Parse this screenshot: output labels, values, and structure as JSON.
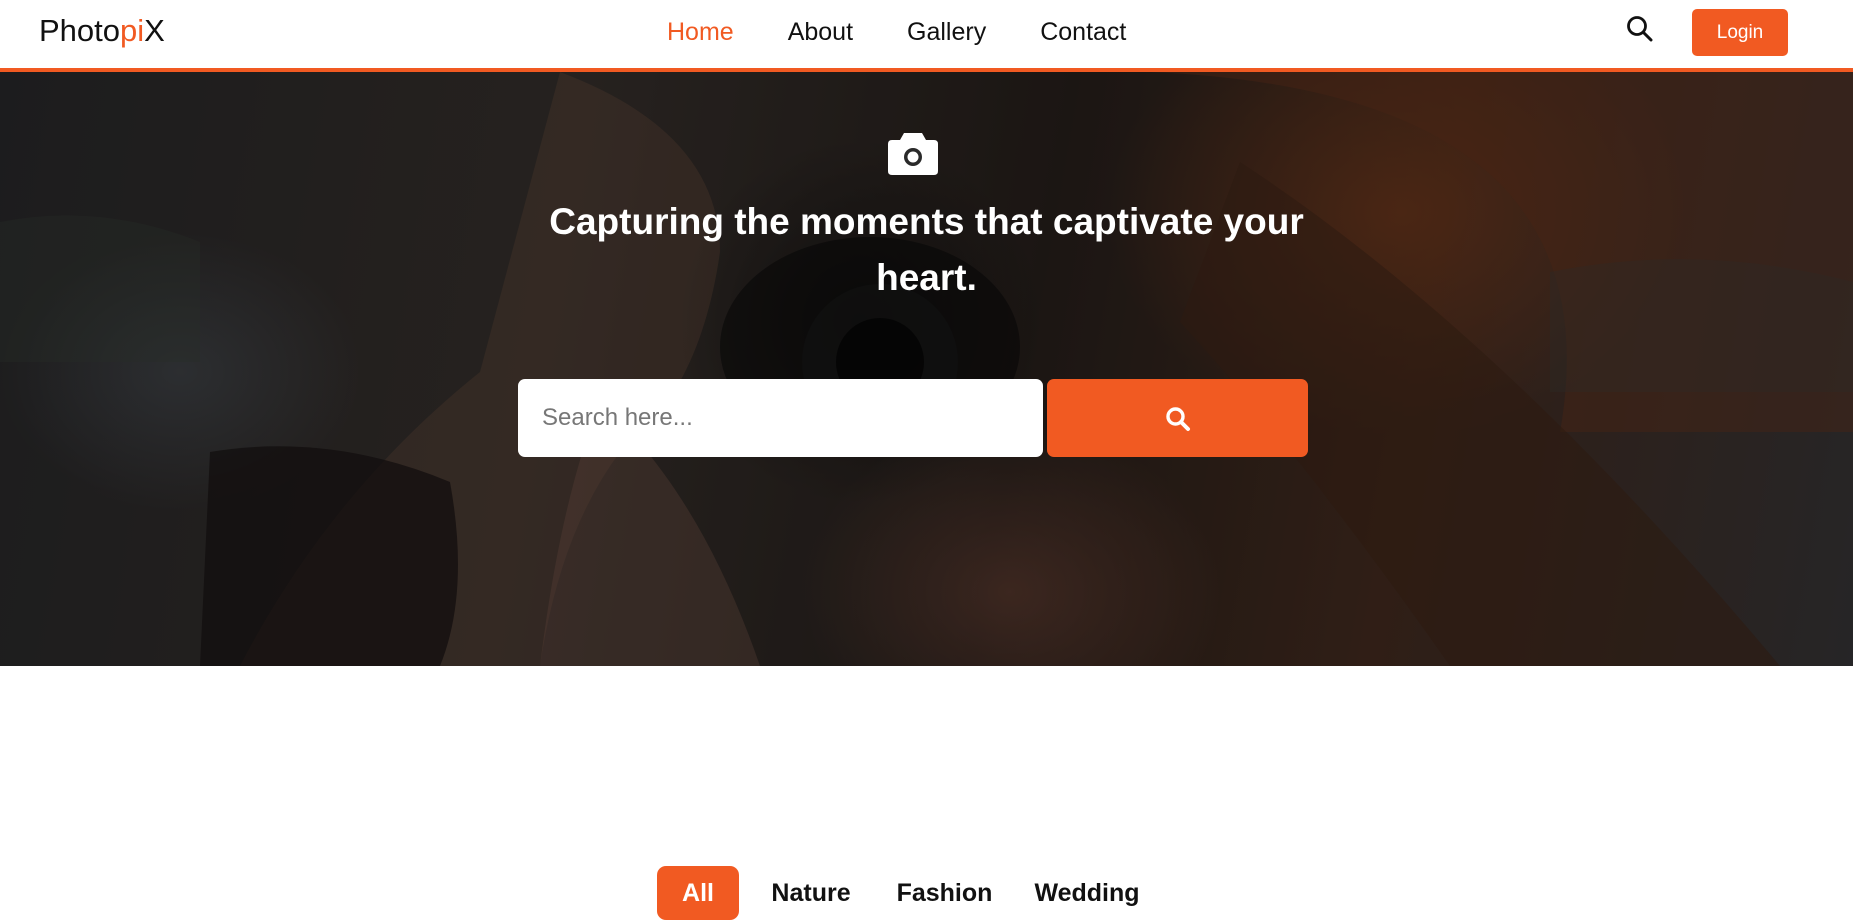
{
  "brand": {
    "name_part1": "Photo",
    "name_accent": "pi",
    "name_part2": "X",
    "accent_color": "#f15a22"
  },
  "nav": {
    "links": [
      {
        "label": "Home",
        "active": true
      },
      {
        "label": "About",
        "active": false
      },
      {
        "label": "Gallery",
        "active": false
      },
      {
        "label": "Contact",
        "active": false
      }
    ],
    "search_icon": "search-icon",
    "login_label": "Login"
  },
  "hero": {
    "icon": "camera-icon",
    "title": "Capturing the moments that captivate your heart.",
    "search": {
      "placeholder": "Search here...",
      "value": "",
      "button_icon": "search-icon"
    }
  },
  "filters": {
    "tabs": [
      {
        "label": "All",
        "active": true
      },
      {
        "label": "Nature",
        "active": false
      },
      {
        "label": "Fashion",
        "active": false
      },
      {
        "label": "Wedding",
        "active": false
      }
    ]
  }
}
